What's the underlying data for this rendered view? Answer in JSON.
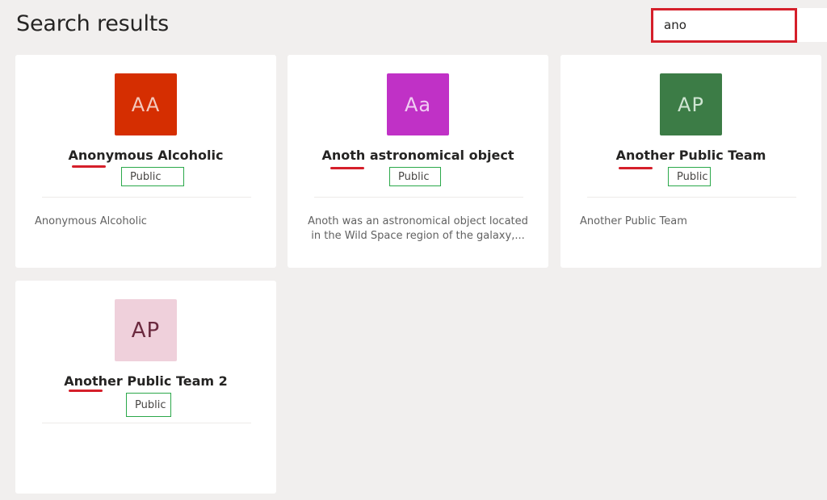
{
  "header": {
    "title": "Search results"
  },
  "search": {
    "value": "ano"
  },
  "teams": [
    {
      "initials": "AA",
      "name": "Anonymous Alcoholic",
      "visibility": "Public",
      "description": "Anonymous Alcoholic",
      "avatar_bg": "#d52e01",
      "avatar_fg": "#f4c9bd"
    },
    {
      "initials": "Aa",
      "name": "Anoth astronomical object",
      "visibility": "Public",
      "description": "Anoth was an astronomical object located in the Wild Space region of the galaxy,...",
      "avatar_bg": "#c031c6",
      "avatar_fg": "#f1cdf3"
    },
    {
      "initials": "AP",
      "name": "Another Public Team",
      "visibility": "Public",
      "description": "Another Public Team",
      "avatar_bg": "#3c7c46",
      "avatar_fg": "#cfe5d2"
    },
    {
      "initials": "AP",
      "name": "Another Public Team 2",
      "visibility": "Public",
      "description": "",
      "avatar_bg": "#efd0db",
      "avatar_fg": "#6b2a3f"
    }
  ],
  "colors": {
    "match_highlight": "#d51f2a",
    "public_badge_border": "#2ba84a"
  }
}
